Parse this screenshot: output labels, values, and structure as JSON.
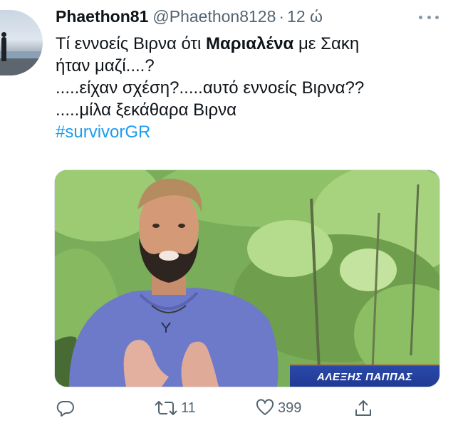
{
  "tweet": {
    "display_name": "Phaethon81",
    "handle": "@Phaethon8128",
    "separator": "·",
    "time": "12 ώ",
    "text": {
      "line1_before": "Τί εννοείς Βιρνα ότι ",
      "line1_bold": "Μαριαλένα",
      "line1_after": " με Σακη",
      "line2": "ήταν μαζί....?",
      "line3": ".....είχαν σχέση?.....αυτό εννοείς Βιρνα??",
      "line4": ".....μίλα ξεκάθαρα Βιρνα",
      "hashtag": "#survivorGR"
    },
    "media": {
      "caption": "ΑΛΕΞΗΣ ΠΑΠΠΑΣ"
    },
    "actions": {
      "reply_icon": "reply-icon",
      "retweet_icon": "retweet-icon",
      "retweet_count": "11",
      "like_icon": "heart-icon",
      "like_count": "399",
      "share_icon": "share-icon"
    }
  },
  "colors": {
    "link": "#1d9bf0",
    "muted": "#536471",
    "caption_bar": "#1f3a93"
  }
}
